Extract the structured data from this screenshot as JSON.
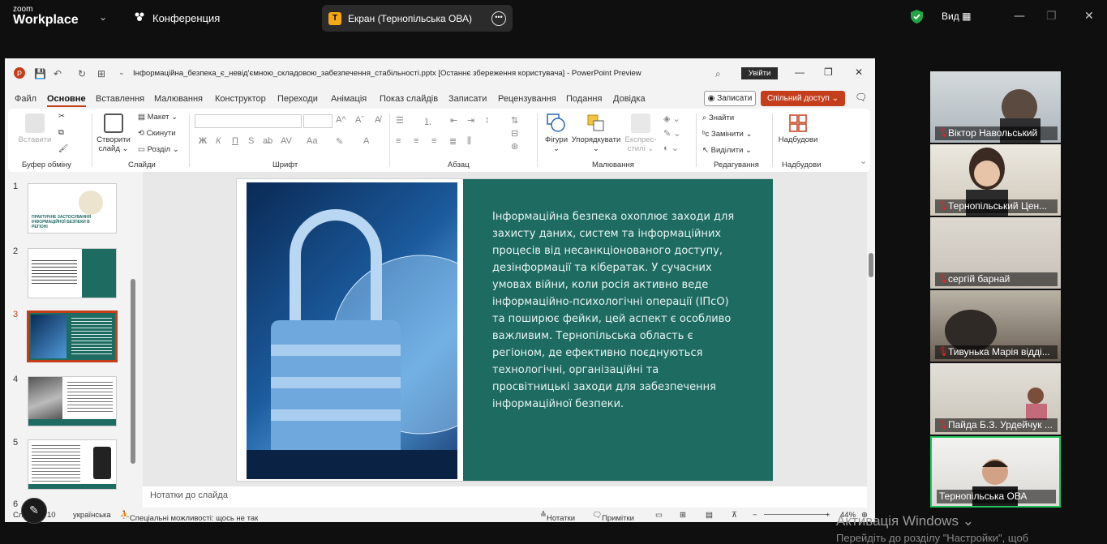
{
  "zoom": {
    "brand_top": "zoom",
    "brand_bottom": "Workplace",
    "meeting": "Конференция",
    "screen_title": "Екран (Тернопільська ОВА)",
    "screen_badge": "T",
    "view_label": "Вид"
  },
  "ppt": {
    "file_title": "Інформаційна_безпека_є_невід'ємною_складовою_забезпечення_стабільності.pptx [Останнє збереження користувача]  -  PowerPoint Preview",
    "sign_in": "Увійти",
    "tabs": [
      "Файл",
      "Основне",
      "Вставлення",
      "Малювання",
      "Конструктор",
      "Переходи",
      "Анімація",
      "Показ слайдів",
      "Записати",
      "Рецензування",
      "Подання",
      "Довідка"
    ],
    "record": "Записати",
    "share": "Спільний доступ",
    "ribbon": {
      "paste": "Вставити",
      "clipboard": "Буфер обміну",
      "new_slide_1": "Створити",
      "new_slide_2": "слайд",
      "layout": "Макет",
      "reset": "Скинути",
      "section": "Розділ",
      "slides": "Слайди",
      "font": "Шрифт",
      "paragraph": "Абзац",
      "shapes": "Фігури",
      "arrange": "Упорядкувати",
      "styles_1": "Експрес-",
      "styles_2": "стилі",
      "drawing": "Малювання",
      "find": "Знайти",
      "replace": "Замінити",
      "select": "Виділити",
      "editing": "Редагування",
      "addins": "Надбудови",
      "addins_group": "Надбудови"
    },
    "thumbs": [
      "1",
      "2",
      "3",
      "4",
      "5",
      "6"
    ],
    "thumb1_title": "ПРАКТИЧНЕ ЗАСТОСУВАННЯ ІНФОРМАЦІЙНОЇ БЕЗПЕКИ В РЕГІОНІ",
    "slide_text": "Інформаційна безпека охоплює заходи для захисту даних, систем та інформаційних процесів від несанкціонованого доступу, дезінформації та кібератак. У сучасних умовах війни, коли росія активно веде інформаційно-психологічні операції (ІПсО) та поширює фейки, цей аспект є особливо важливим. Тернопільська область є регіоном, де ефективно поєднуються технологічні, організаційні та просвітницькі заходи для забезпечення інформаційної безпеки.",
    "notes": "Нотатки до слайда",
    "status": {
      "slide": "Сла",
      "slide_total": "10",
      "language": "українська",
      "accessibility": "Спеціальні можливості: щось не так",
      "notes": "Нотатки",
      "comments": "Примітки",
      "zoom": "44%"
    }
  },
  "participants": [
    {
      "name": "Віктор Навольський"
    },
    {
      "name": "Тернопільський Цен..."
    },
    {
      "name": "сергій барнай"
    },
    {
      "name": "Тивунька Марія відді..."
    },
    {
      "name": "Пайда Б.З. Урдейчук ..."
    },
    {
      "name": "Тернопільська ОВА"
    }
  ],
  "watermark": {
    "line1": "Активація Windows",
    "line2": "Перейдіть до розділу \"Настройки\", щоб"
  },
  "colors": {
    "accent": "#c43e1c",
    "slide_panel": "#1e6b62",
    "active_speaker": "#22c55e"
  }
}
